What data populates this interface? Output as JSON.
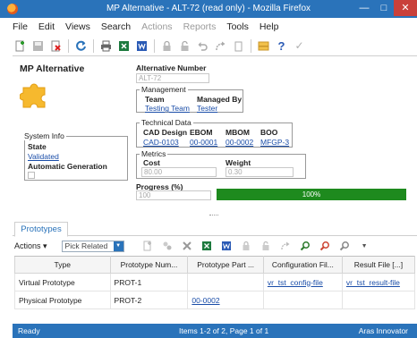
{
  "window": {
    "title": "MP Alternative - ALT-72 (read only) - Mozilla Firefox",
    "minimize": "—",
    "maximize": "□",
    "close": "✕"
  },
  "menu": {
    "items": [
      {
        "label": "File",
        "enabled": true
      },
      {
        "label": "Edit",
        "enabled": true
      },
      {
        "label": "Views",
        "enabled": true
      },
      {
        "label": "Search",
        "enabled": true
      },
      {
        "label": "Actions",
        "enabled": false
      },
      {
        "label": "Reports",
        "enabled": false
      },
      {
        "label": "Tools",
        "enabled": true
      },
      {
        "label": "Help",
        "enabled": true
      }
    ]
  },
  "toolbar": {
    "icons": [
      "new-item-icon",
      "save-icon",
      "delete-icon",
      "refresh-icon",
      "print-icon",
      "export-excel-icon",
      "export-word-icon",
      "lock-icon",
      "unlock-icon",
      "undo-icon",
      "promote-icon",
      "attach-icon",
      "toggle-panel-icon",
      "help-icon",
      "done-icon"
    ],
    "help_glyph": "?",
    "done_glyph": "✓"
  },
  "form": {
    "title": "MP Alternative",
    "alternative_number_label": "Alternative Number",
    "alternative_number": "ALT-72",
    "management": {
      "legend": "Management",
      "team_label": "Team",
      "team_value": "Testing Team",
      "managed_by_label": "Managed By",
      "managed_by_value": "Tester"
    },
    "technical_data": {
      "legend": "Technical Data",
      "cad_label": "CAD Design",
      "cad_value": "CAD-0103",
      "ebom_label": "EBOM",
      "ebom_value": "00-0001",
      "mbom_label": "MBOM",
      "mbom_value": "00-0002",
      "boo_label": "BOO",
      "boo_value": "MFGP-3"
    },
    "metrics": {
      "legend": "Metrics",
      "cost_label": "Cost",
      "cost_value": "80.00",
      "weight_label": "Weight",
      "weight_value": "0.30"
    },
    "progress": {
      "label": "Progress (%)",
      "value": "100",
      "bar_text": "100%",
      "percent": 100
    },
    "system_info": {
      "legend": "System Info",
      "state_label": "State",
      "state_value": "Validated",
      "auto_gen_label": "Automatic Generation"
    }
  },
  "relationships": {
    "tab_label": "Prototypes",
    "actions_label": "Actions ▾",
    "pick_related": "Pick Related",
    "columns": [
      "Type",
      "Prototype Num...",
      "Prototype Part ...",
      "Configuration Fil...",
      "Result File [...]"
    ],
    "rows": [
      {
        "type": "Virtual Prototype",
        "number": "PROT-1",
        "part": "",
        "config": "vr_tst_config-file",
        "result": "vr_tst_result-file"
      },
      {
        "type": "Physical Prototype",
        "number": "PROT-2",
        "part": "00-0002",
        "config": "",
        "result": ""
      }
    ]
  },
  "status": {
    "left": "Ready",
    "middle": "Items 1-2 of 2, Page 1 of 1",
    "right": "Aras Innovator"
  },
  "colors": {
    "titlebar": "#2a73ba",
    "progress": "#1e8a1e",
    "link": "#1a4da8"
  }
}
